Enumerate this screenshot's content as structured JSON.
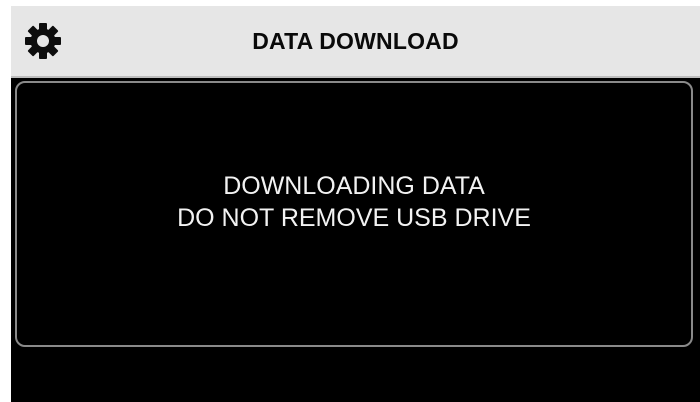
{
  "header": {
    "title": "DATA DOWNLOAD",
    "settings_icon": "gear-icon"
  },
  "message": {
    "line1": "DOWNLOADING DATA",
    "line2": "DO NOT REMOVE USB DRIVE"
  },
  "colors": {
    "header_background": "#e6e6e6",
    "screen_background": "#000000",
    "message_text": "#f2f2f2",
    "panel_border": "#8a8a8a"
  }
}
